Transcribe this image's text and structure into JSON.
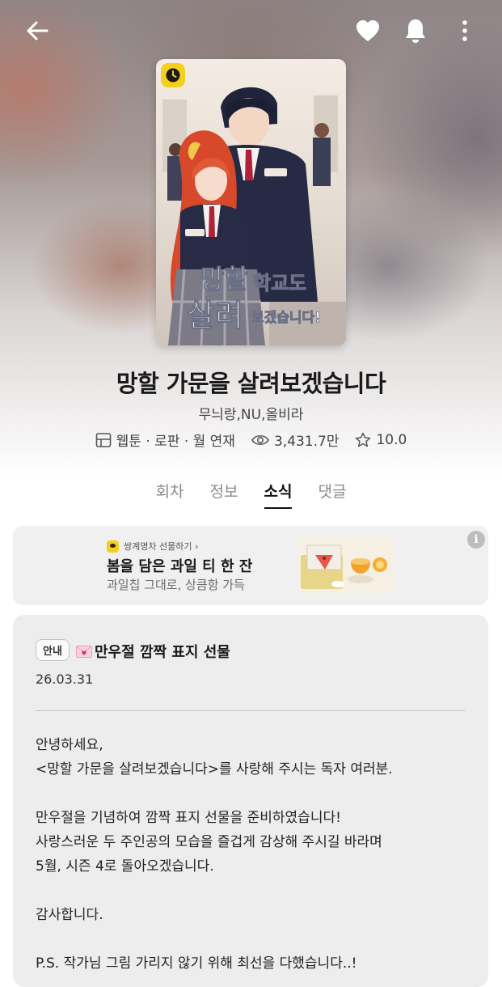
{
  "header": {
    "back_icon": "back-arrow-icon",
    "like_icon": "heart-icon",
    "alarm_icon": "bell-icon",
    "more_icon": "more-vertical-icon"
  },
  "series": {
    "badge_icon": "clock-icon",
    "title": "망할 가문을 살려보겠습니다",
    "authors": "무늬랑,NU,올비라",
    "genre": "웹툰 · 로판 · 월 연재",
    "views": "3,431.7만",
    "rating": "10.0"
  },
  "tabs": [
    {
      "label": "회차",
      "active": false
    },
    {
      "label": "정보",
      "active": false
    },
    {
      "label": "소식",
      "active": true
    },
    {
      "label": "댓글",
      "active": false
    }
  ],
  "ad": {
    "brand": "쌍계명차 선물하기 ›",
    "title": "봄을 담은 과일 티 한 잔",
    "subtitle": "과일칩 그대로, 상큼함 가득",
    "info_label": "i"
  },
  "notice": {
    "badge": "안내",
    "title": "만우절 깜짝 표지 선물",
    "date": "26.03.31",
    "paragraphs": [
      "안녕하세요,\n<망할 가문을 살려보겠습니다>를 사랑해 주시는 독자 여러분.",
      "만우절을 기념하여 깜짝 표지 선물을 준비하였습니다!\n사랑스러운 두 주인공의 모습을 즐겁게 감상해 주시길 바라며\n5월, 시즌 4로 돌아오겠습니다.",
      "감사합니다.",
      "P.S. 작가님 그림 가리지 않기 위해 최선을 다했습니다..!"
    ]
  },
  "colors": {
    "kakao_yellow": "#f5cf1c",
    "active_tab": "#111111",
    "inactive_tab": "#8a8a8a"
  }
}
